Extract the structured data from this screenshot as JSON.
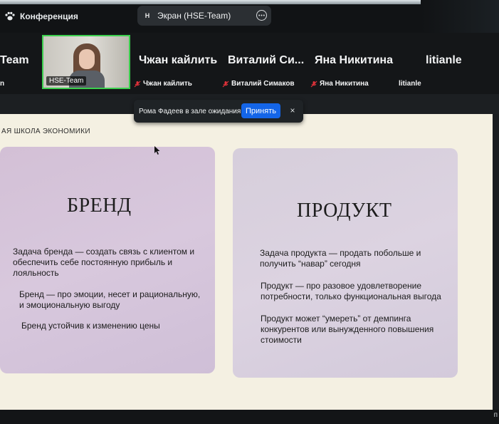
{
  "app": {
    "title": "Конференция",
    "screen_share_badge": "H",
    "screen_share_title": "Экран (HSE-Team)",
    "more_icon": "more-horizontal-icon"
  },
  "participants": [
    {
      "display_name": "Team",
      "caption": "n"
    },
    {
      "display_name": "",
      "caption": "HSE-Team",
      "video": true
    },
    {
      "display_name": "Чжан кайлить",
      "caption": "Чжан кайлить",
      "muted": true
    },
    {
      "display_name": "Виталий Си...",
      "caption": "Виталий Симаков",
      "muted": true
    },
    {
      "display_name": "Яна Никитина",
      "caption": "Яна Никитина",
      "muted": true
    },
    {
      "display_name": "litianle",
      "caption": "litianle",
      "muted": false
    }
  ],
  "waiting_room": {
    "message": "Рома Фадеев в зале ожидания",
    "admit_label": "Принять",
    "close_label": "×"
  },
  "slide": {
    "header": "АЯ ШКОЛА ЭКОНОМИКИ",
    "brand": {
      "title": "БРЕНД",
      "points": [
        "Задача бренда — создать связь с клиентом и обеспечить себе постоянную прибыль и лояльность",
        "Бренд — про эмоции, несет и рациональную, и эмоциональную выгоду",
        "Бренд устойчив к изменению цены"
      ]
    },
    "product": {
      "title": "ПРОДУКТ",
      "points": [
        "Задача продукта — продать побольше и получить “навар” сегодня",
        "Продукт — про разовое удовлетворение потребности, только функциональная выгода",
        "Продукт может “умереть” от демпинга конкурентов или вынужденного повышения стоимости"
      ]
    }
  },
  "bottom": {
    "fragment": "п"
  },
  "colors": {
    "accent": "#1465e8",
    "active_speaker": "#3ccf4e",
    "muted": "#e0323a"
  }
}
